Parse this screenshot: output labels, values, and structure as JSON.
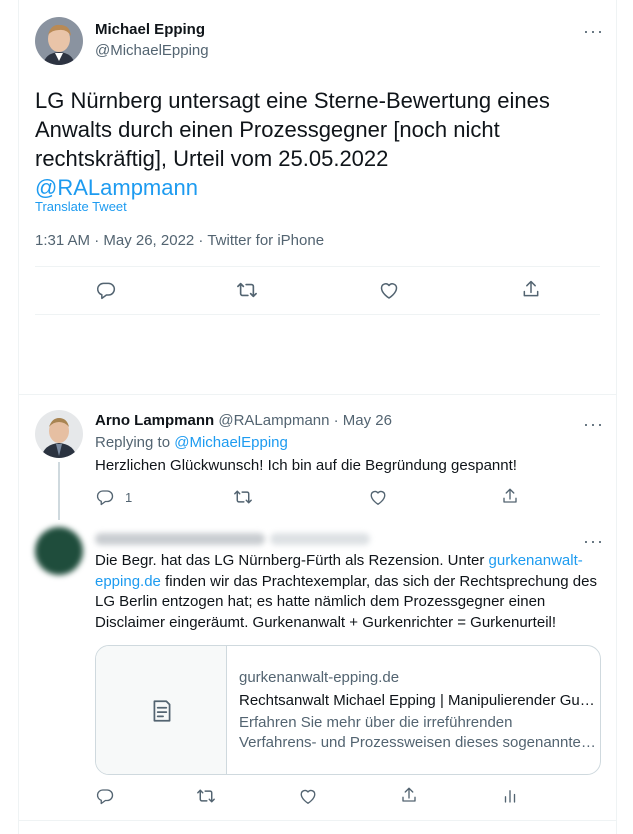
{
  "main_tweet": {
    "author_name": "Michael Epping",
    "author_handle": "@MichaelEpping",
    "text": "LG Nürnberg untersagt eine Sterne-Bewertung eines Anwalts durch einen Prozessgegner [noch nicht rechtskräftig], Urteil vom 25.05.2022",
    "mention": "@RALampmann",
    "translate_label": "Translate Tweet",
    "meta": "1:31 AM · May 26, 2022 · Twitter for iPhone"
  },
  "reply1": {
    "author_name": "Arno Lampmann",
    "author_handle": "@RALampmann · May 26",
    "replying_prefix": "Replying to ",
    "replying_to": "@MichaelEpping",
    "text": "Herzlichen Glückwunsch! Ich bin auf die Begründung gespannt!",
    "reply_count": "1"
  },
  "reply2": {
    "text_part1": "Die Begr. hat das LG Nürnberg-Fürth als Rezension. Unter ",
    "link_line1": "gurkenanwalt-",
    "link_line2": "epping.de",
    "text_part2": " finden wir das Prachtexemplar, das sich der Rechtsprechung des LG Berlin entzogen hat; es hatte nämlich dem Prozessgegner einen Disclaimer eingeräumt. Gurkenanwalt + Gurkenrichter = Gurkenurteil!",
    "card": {
      "domain": "gurkenanwalt-epping.de",
      "title": "Rechtsanwalt Michael Epping | Manipulierender Gu…",
      "desc_line1": "Erfahren Sie mehr über die irreführenden",
      "desc_line2": "Verfahrens- und Prozessweisen dieses sogenannte…"
    }
  },
  "icons": [
    "reply-icon",
    "retweet-icon",
    "like-icon",
    "share-icon",
    "analytics-icon",
    "document-icon",
    "more-icon"
  ],
  "colors": {
    "link": "#1d9bf0",
    "secondary": "#536471",
    "text": "#0f1419",
    "border": "#eff3f4"
  }
}
